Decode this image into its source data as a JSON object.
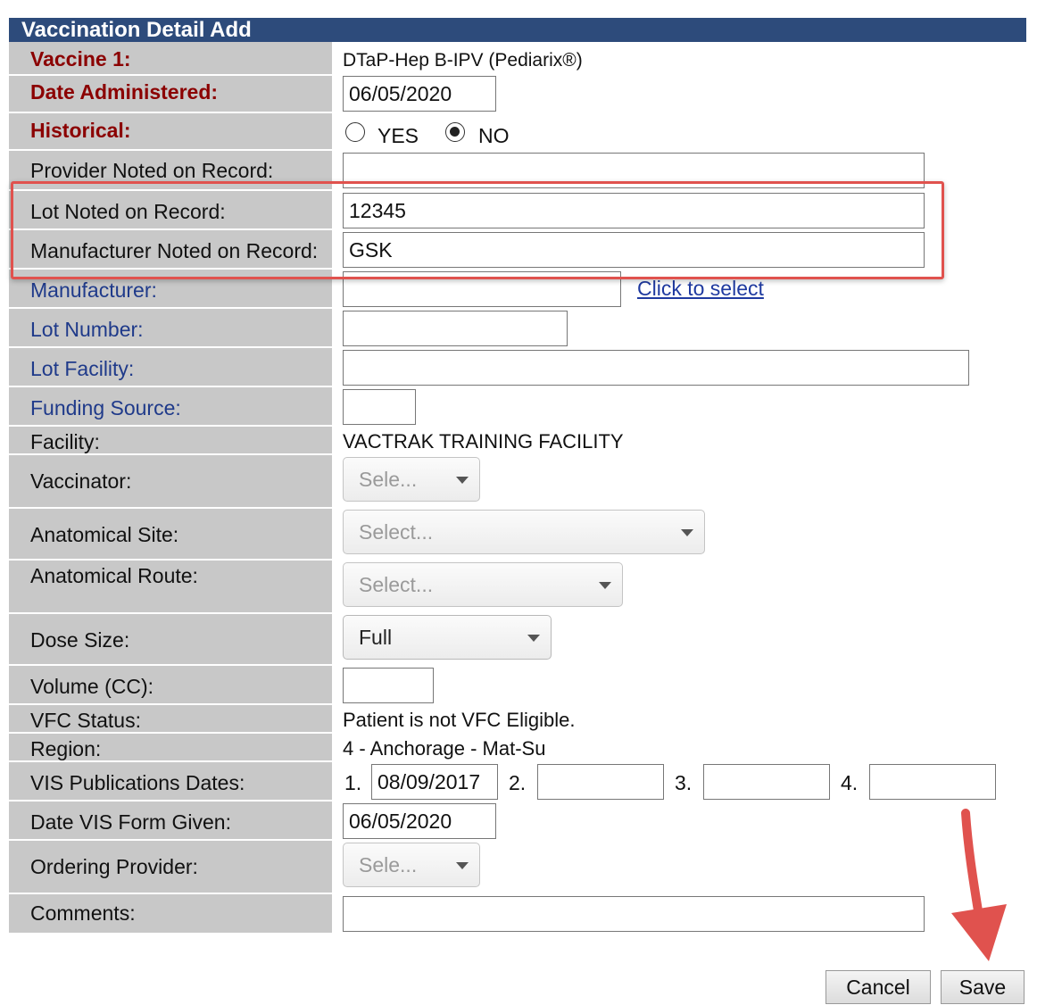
{
  "title": "Vaccination Detail Add",
  "fields": {
    "vaccine": {
      "label": "Vaccine 1:",
      "value": "DTaP-Hep B-IPV (Pediarix®)"
    },
    "date_administered": {
      "label": "Date Administered:",
      "value": "06/05/2020"
    },
    "historical": {
      "label": "Historical:",
      "yes": "YES",
      "no": "NO",
      "selected": "NO"
    },
    "provider_noted": {
      "label": "Provider Noted on Record:",
      "value": ""
    },
    "lot_noted": {
      "label": "Lot Noted on Record:",
      "value": "12345"
    },
    "manufacturer_noted": {
      "label": "Manufacturer Noted on Record:",
      "value": "GSK"
    },
    "manufacturer": {
      "label": "Manufacturer:",
      "value": "",
      "link": "Click to select"
    },
    "lot_number": {
      "label": "Lot Number:",
      "value": ""
    },
    "lot_facility": {
      "label": "Lot Facility:",
      "value": ""
    },
    "funding_source": {
      "label": "Funding Source:",
      "value": ""
    },
    "facility": {
      "label": "Facility:",
      "value": "VACTRAK TRAINING FACILITY"
    },
    "vaccinator": {
      "label": "Vaccinator:",
      "value": "Sele..."
    },
    "anatomical_site": {
      "label": "Anatomical Site:",
      "value": "Select..."
    },
    "anatomical_route": {
      "label": "Anatomical Route:",
      "value": "Select..."
    },
    "dose_size": {
      "label": "Dose Size:",
      "value": "Full"
    },
    "volume": {
      "label": "Volume (CC):",
      "value": ""
    },
    "vfc_status": {
      "label": "VFC Status:",
      "value": "Patient is not VFC Eligible."
    },
    "region": {
      "label": "Region:",
      "value": "4 - Anchorage - Mat-Su"
    },
    "vis_dates": {
      "label": "VIS Publications Dates:",
      "n1": "1.",
      "n2": "2.",
      "n3": "3.",
      "n4": "4.",
      "d1": "08/09/2017",
      "d2": "",
      "d3": "",
      "d4": ""
    },
    "date_vis_given": {
      "label": "Date VIS Form Given:",
      "value": "06/05/2020"
    },
    "ordering_provider": {
      "label": "Ordering Provider:",
      "value": "Sele..."
    },
    "comments": {
      "label": "Comments:",
      "value": ""
    }
  },
  "buttons": {
    "cancel": "Cancel",
    "save": "Save"
  },
  "colors": {
    "header": "#2d4b7b",
    "label_bg": "#c8c8c8",
    "required": "#8b0000",
    "link": "#1f3a8a",
    "annotation": "#e0524e"
  }
}
